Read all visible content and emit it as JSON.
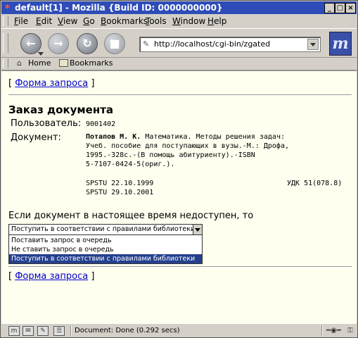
{
  "window": {
    "title": "default[1] - Mozilla {Build ID: 0000000000}",
    "buttons": {
      "minimize": "_",
      "maximize": "□",
      "close": "×"
    }
  },
  "menu": {
    "items": [
      {
        "mnemonic": "F",
        "rest": "ile"
      },
      {
        "mnemonic": "E",
        "rest": "dit"
      },
      {
        "mnemonic": "V",
        "rest": "iew"
      },
      {
        "mnemonic": "G",
        "rest": "o"
      },
      {
        "mnemonic": "B",
        "rest": "ookmarks"
      },
      {
        "mnemonic": "T",
        "rest": "ools"
      },
      {
        "mnemonic": "W",
        "rest": "indow"
      },
      {
        "mnemonic": "H",
        "rest": "elp"
      }
    ]
  },
  "nav": {
    "back_icon": "back-arrow-icon",
    "forward_icon": "forward-arrow-icon",
    "reload_icon": "reload-icon",
    "stop_icon": "stop-icon",
    "url": "http://localhost/cgi-bin/zgated"
  },
  "personal_toolbar": {
    "home_label": "Home",
    "bookmarks_label": "Bookmarks"
  },
  "page": {
    "top_link_prefix": "[ ",
    "top_link": "Форма запроса",
    "top_link_suffix": " ]",
    "heading": "Заказ документа",
    "user_label": "Пользователь:",
    "user_value": "9001402",
    "doc_label": "Документ:",
    "doc_author": "Потапов М. К.",
    "doc_line1": " Математика. Методы решения задач:",
    "doc_line2": "Учеб. пособие для поступающих в вузы.-М.: Дрофа,",
    "doc_line3": "1995.-328с.-(В помощь абитуриенту).-ISBN",
    "doc_line4": "5-7107-0424-5(ориг.).",
    "holding1": "SPSTU 22.10.1999",
    "holding2": "SPSTU 29.10.2001",
    "udk": "УДК 51(078.8)",
    "unavailable_text": "Если документ в настоящее время недоступен, то",
    "select_value": "Поступить в соответствии с правилами библиотеки",
    "options": [
      "Поставить запрос в очередь",
      "Не ставить запрос в очередь",
      "Поступить в соответствии с правилами библиотеки"
    ],
    "selected_option_index": 2,
    "bottom_link_prefix": "[ ",
    "bottom_link": "Форма запроса",
    "bottom_link_suffix": " ]"
  },
  "status": {
    "text": "Document: Done (0.292 secs)",
    "icons": [
      "mozilla-icon",
      "mail-icon",
      "composer-icon",
      "addressbook-icon"
    ]
  }
}
